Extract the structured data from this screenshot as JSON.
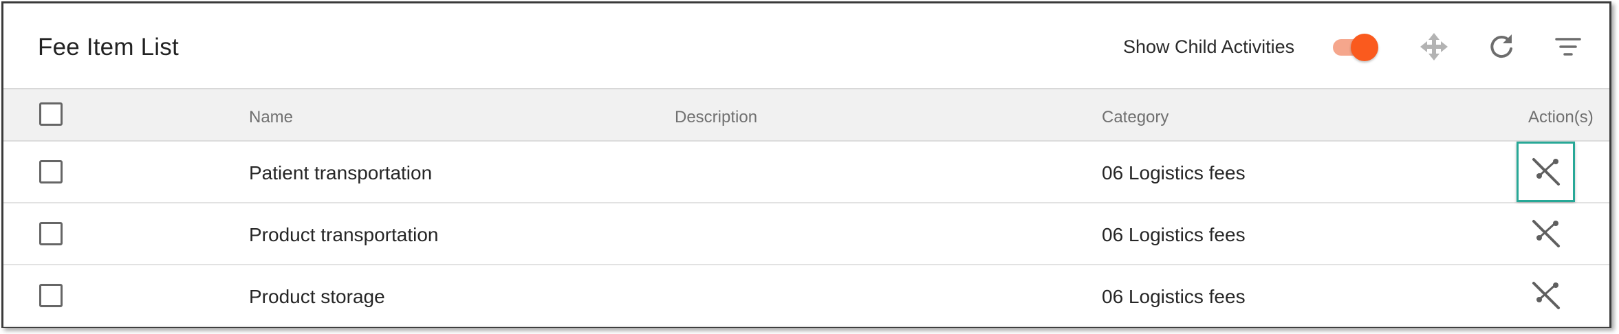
{
  "header": {
    "title": "Fee Item List",
    "toggle_label": "Show Child Activities",
    "toggle_on": true,
    "icons": [
      "move-icon",
      "refresh-icon",
      "filter-icon"
    ]
  },
  "table": {
    "columns": [
      "Name",
      "Description",
      "Category",
      "Action(s)"
    ],
    "rows": [
      {
        "name": "Patient transportation",
        "description": "",
        "category": "06 Logistics fees",
        "action_icon": "unlink-icon"
      },
      {
        "name": "Product transportation",
        "description": "",
        "category": "06 Logistics fees",
        "action_icon": "unlink-icon"
      },
      {
        "name": "Product storage",
        "description": "",
        "category": "06 Logistics fees",
        "action_icon": "unlink-icon"
      }
    ]
  },
  "colors": {
    "accent": "#fa5a1e",
    "accent_track": "#f5a68c",
    "focus_outline": "#28a897",
    "header_bg": "#f1f1f1"
  }
}
